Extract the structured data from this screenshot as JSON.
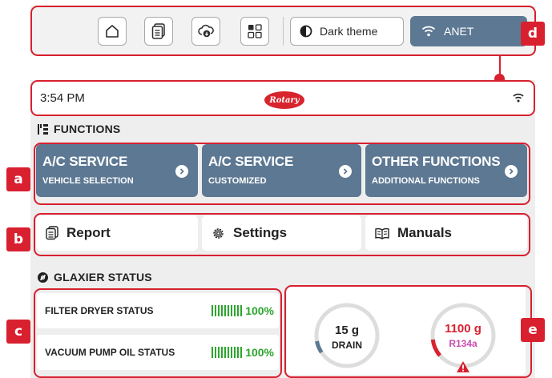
{
  "toolbar": {
    "buttons": [
      {
        "icon": "home-icon"
      },
      {
        "icon": "report-icon"
      },
      {
        "icon": "cloud-update-icon"
      },
      {
        "icon": "apps-grid-icon"
      }
    ],
    "theme_label": "Dark theme",
    "network_label": "ANET"
  },
  "status": {
    "time": "3:54 PM",
    "logo_text": "Rotary"
  },
  "functions": {
    "title": "FUNCTIONS",
    "cards": [
      {
        "title": "A/C SERVICE",
        "subtitle": "VEHICLE SELECTION"
      },
      {
        "title": "A/C SERVICE",
        "subtitle": "CUSTOMIZED"
      },
      {
        "title": "OTHER FUNCTIONS",
        "subtitle": "ADDITIONAL FUNCTIONS"
      }
    ],
    "utilities": [
      {
        "label": "Report",
        "icon": "report-icon"
      },
      {
        "label": "Settings",
        "icon": "gear-icon"
      },
      {
        "label": "Manuals",
        "icon": "book-icon"
      }
    ]
  },
  "glaxier": {
    "title": "GLAXIER STATUS",
    "items": [
      {
        "label": "FILTER DRYER STATUS",
        "value": "100%",
        "level": 1.0
      },
      {
        "label": "VACUUM PUMP OIL STATUS",
        "value": "100%",
        "level": 1.0
      }
    ],
    "gauges": [
      {
        "amount": "15 g",
        "label": "DRAIN",
        "color": "#5d7893"
      },
      {
        "amount": "1100 g",
        "label": "R134a",
        "color": "#d8202f",
        "label_color": "#c94fb0"
      }
    ]
  },
  "annotations": [
    "a",
    "b",
    "c",
    "d",
    "e"
  ],
  "colors": {
    "accent": "#5d7893",
    "callout": "#d8202f",
    "ok": "#2da62e"
  }
}
